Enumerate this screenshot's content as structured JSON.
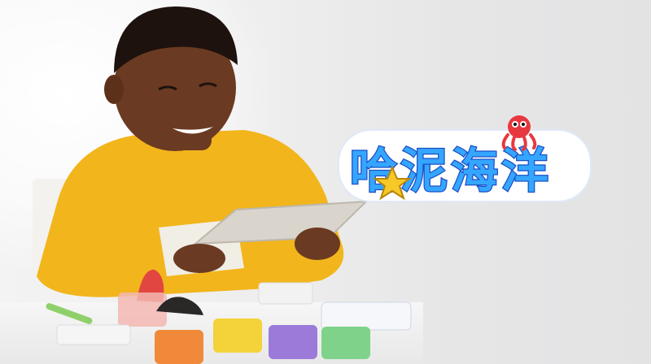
{
  "photo": {
    "subject": "",
    "colors": {
      "shirt": "#f2b51c",
      "skin": "#6b3a22",
      "tablet": "#d9d4cc",
      "background": "#ececec"
    }
  },
  "logo": {
    "text": "哈泥海洋",
    "mascot_icon": "octopus-icon",
    "star_icon": "star-icon",
    "colors": {
      "fill": "#35a6ff",
      "outline": "#1c4fc4",
      "octopus": "#e8383f",
      "star": "#f7c928"
    }
  },
  "props": [
    {
      "name": "red-clay-tub",
      "color": "#e24640"
    },
    {
      "name": "orange-clay-tub",
      "color": "#f08a3a"
    },
    {
      "name": "yellow-clay-tub",
      "color": "#f4d23a"
    },
    {
      "name": "purple-clay-tub",
      "color": "#9b7ad9"
    },
    {
      "name": "green-clay-tub",
      "color": "#7fd28a"
    }
  ]
}
